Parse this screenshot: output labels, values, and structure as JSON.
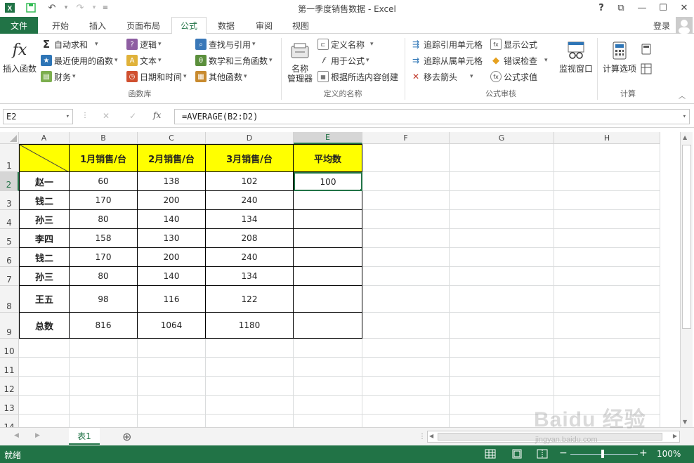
{
  "window": {
    "title": "第一季度销售数据 - Excel",
    "help": "?",
    "restore_ribbon": "⧉",
    "minimize": "—",
    "maximize": "☐",
    "close": "✕"
  },
  "quick_access": {
    "save": "💾",
    "undo": "↶",
    "redo": "↷",
    "customize": "≡"
  },
  "tabs": [
    "文件",
    "开始",
    "插入",
    "页面布局",
    "公式",
    "数据",
    "审阅",
    "视图"
  ],
  "active_tab": "公式",
  "account": "登录",
  "ribbon": {
    "function_library": {
      "insert_function": "插入函数",
      "autosum": "自动求和",
      "recent": "最近使用的函数",
      "financial": "财务",
      "logical": "逻辑",
      "text": "文本",
      "datetime": "日期和时间",
      "lookup": "查找与引用",
      "math": "数学和三角函数",
      "other": "其他函数",
      "label": "函数库"
    },
    "defined_names": {
      "name_manager_1": "名称",
      "name_manager_2": "管理器",
      "define_name": "定义名称",
      "use_in_formula": "用于公式",
      "create_from_selection": "根据所选内容创建",
      "label": "定义的名称"
    },
    "formula_auditing": {
      "trace_precedents": "追踪引用单元格",
      "trace_dependents": "追踪从属单元格",
      "remove_arrows": "移去箭头",
      "show_formulas": "显示公式",
      "error_checking": "错误检查",
      "evaluate_formula": "公式求值",
      "watch_window": "监视窗口",
      "label": "公式审核"
    },
    "calculation": {
      "calc_options": "计算选项",
      "label": "计算"
    }
  },
  "formula_bar": {
    "name_box": "E2",
    "cancel": "✕",
    "enter": "✓",
    "fx": "fx",
    "formula": "=AVERAGE(B2:D2)"
  },
  "columns": [
    "A",
    "B",
    "C",
    "D",
    "E",
    "F",
    "G",
    "H"
  ],
  "rows": [
    "1",
    "2",
    "3",
    "4",
    "5",
    "6",
    "7",
    "8",
    "9",
    "10",
    "11",
    "12",
    "13",
    "14"
  ],
  "table": {
    "headers": [
      "",
      "1月销售/台",
      "2月销售/台",
      "3月销售/台",
      "平均数"
    ],
    "data": [
      [
        "赵一",
        "60",
        "138",
        "102",
        "100"
      ],
      [
        "钱二",
        "170",
        "200",
        "240",
        ""
      ],
      [
        "孙三",
        "80",
        "140",
        "134",
        ""
      ],
      [
        "李四",
        "158",
        "130",
        "208",
        ""
      ],
      [
        "钱二",
        "170",
        "200",
        "240",
        ""
      ],
      [
        "孙三",
        "80",
        "140",
        "134",
        ""
      ],
      [
        "王五",
        "98",
        "116",
        "122",
        ""
      ],
      [
        "总数",
        "816",
        "1064",
        "1180",
        ""
      ]
    ]
  },
  "sheet_tabs": [
    "表1"
  ],
  "add_sheet": "⊕",
  "status": {
    "ready": "就绪",
    "zoom": "100%"
  },
  "watermark": {
    "line1": "Baidu 经验",
    "line2": "jingyan.baidu.com"
  },
  "colors": {
    "excel_green": "#217346",
    "header_yellow": "#ffff00"
  }
}
